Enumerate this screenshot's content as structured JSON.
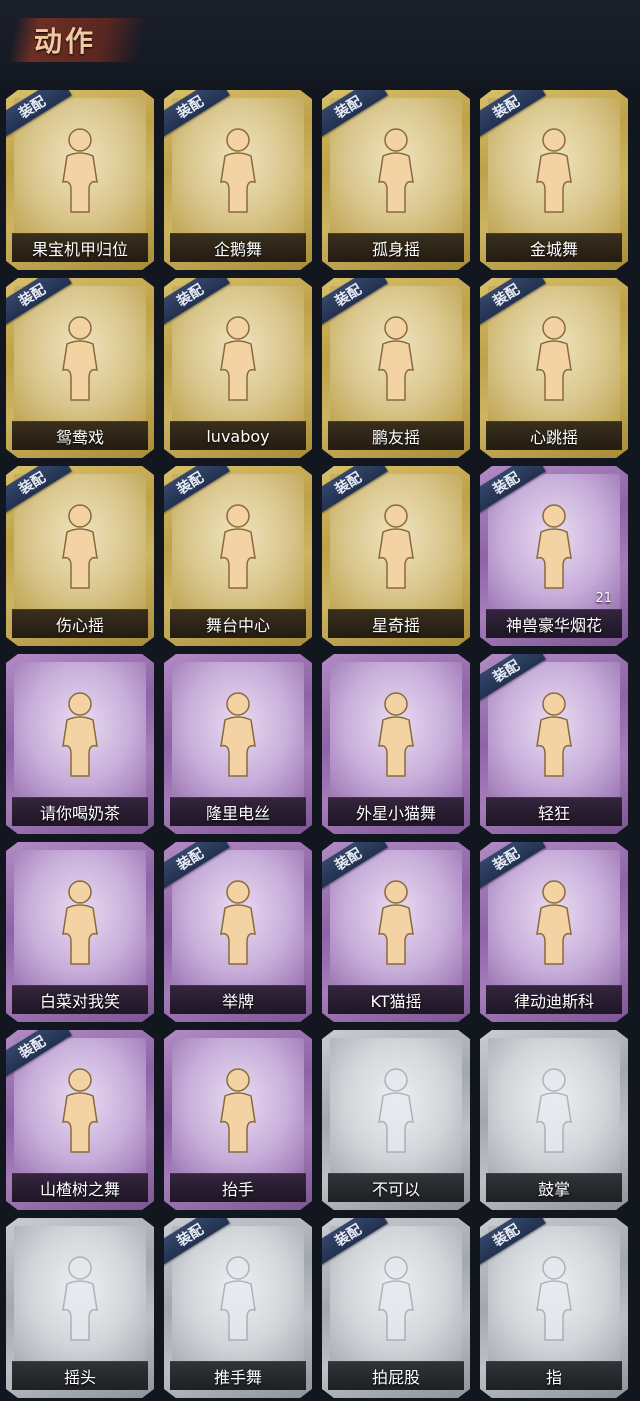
{
  "header": {
    "title": "动作"
  },
  "badge_text": "装配",
  "colors": {
    "gold": "#c8ae58",
    "purple": "#9a72b0",
    "gray": "#b4b8be",
    "badge": "#2a3a5c"
  },
  "cards": [
    {
      "label": "果宝机甲归位",
      "rarity": "gold",
      "equipped": true,
      "icon": "figure-arms-out-icon",
      "count": ""
    },
    {
      "label": "企鹅舞",
      "rarity": "gold",
      "equipped": true,
      "icon": "figure-dance-icon",
      "count": ""
    },
    {
      "label": "孤身摇",
      "rarity": "gold",
      "equipped": true,
      "icon": "figure-stars-icon",
      "count": ""
    },
    {
      "label": "金城舞",
      "rarity": "gold",
      "equipped": true,
      "icon": "figure-wave-icon",
      "count": ""
    },
    {
      "label": "鸳鸯戏",
      "rarity": "gold",
      "equipped": true,
      "icon": "figure-music-icon",
      "count": ""
    },
    {
      "label": "luvaboy",
      "rarity": "gold",
      "equipped": true,
      "icon": "figure-cross-arms-icon",
      "count": ""
    },
    {
      "label": "鹏友摇",
      "rarity": "gold",
      "equipped": true,
      "icon": "figure-point-icon",
      "count": ""
    },
    {
      "label": "心跳摇",
      "rarity": "gold",
      "equipped": true,
      "icon": "figure-arm-up-icon",
      "count": ""
    },
    {
      "label": "伤心摇",
      "rarity": "gold",
      "equipped": true,
      "icon": "figure-heart-icon",
      "count": ""
    },
    {
      "label": "舞台中心",
      "rarity": "gold",
      "equipped": true,
      "icon": "figure-pose-icon",
      "count": ""
    },
    {
      "label": "星奇摇",
      "rarity": "gold",
      "equipped": true,
      "icon": "figure-point-icon",
      "count": ""
    },
    {
      "label": "神兽豪华烟花",
      "rarity": "purple",
      "equipped": true,
      "icon": "fireworks-icon",
      "count": "21"
    },
    {
      "label": "请你喝奶茶",
      "rarity": "purple",
      "equipped": false,
      "icon": "figure-sign-icon",
      "count": ""
    },
    {
      "label": "隆里电丝",
      "rarity": "purple",
      "equipped": false,
      "icon": "figure-music-icon",
      "count": ""
    },
    {
      "label": "外星小猫舞",
      "rarity": "purple",
      "equipped": false,
      "icon": "figure-dance-icon",
      "count": ""
    },
    {
      "label": "轻狂",
      "rarity": "purple",
      "equipped": true,
      "icon": "horned-girl-icon",
      "count": ""
    },
    {
      "label": "白菜对我笑",
      "rarity": "purple",
      "equipped": false,
      "icon": "figure-cross-arms-icon",
      "count": ""
    },
    {
      "label": "举牌",
      "rarity": "purple",
      "equipped": true,
      "icon": "figure-sign-icon",
      "count": ""
    },
    {
      "label": "KT猫摇",
      "rarity": "purple",
      "equipped": true,
      "icon": "figure-music-icon",
      "count": ""
    },
    {
      "label": "律动迪斯科",
      "rarity": "purple",
      "equipped": true,
      "icon": "figure-arm-up-icon",
      "count": ""
    },
    {
      "label": "山楂树之舞",
      "rarity": "purple",
      "equipped": true,
      "icon": "figure-arm-up-icon",
      "count": ""
    },
    {
      "label": "抬手",
      "rarity": "purple",
      "equipped": false,
      "icon": "figure-arms-out-icon",
      "count": ""
    },
    {
      "label": "不可以",
      "rarity": "gray",
      "equipped": false,
      "icon": "finger-wag-icon",
      "count": ""
    },
    {
      "label": "鼓掌",
      "rarity": "gray",
      "equipped": false,
      "icon": "clap-icon",
      "count": ""
    },
    {
      "label": "摇头",
      "rarity": "gray",
      "equipped": false,
      "icon": "figure-arms-out-icon",
      "count": ""
    },
    {
      "label": "推手舞",
      "rarity": "gray",
      "equipped": true,
      "icon": "figure-dance-icon",
      "count": ""
    },
    {
      "label": "拍屁股",
      "rarity": "gray",
      "equipped": true,
      "icon": "figure-pose-icon",
      "count": ""
    },
    {
      "label": "指",
      "rarity": "gray",
      "equipped": true,
      "icon": "point-icon",
      "count": ""
    }
  ]
}
